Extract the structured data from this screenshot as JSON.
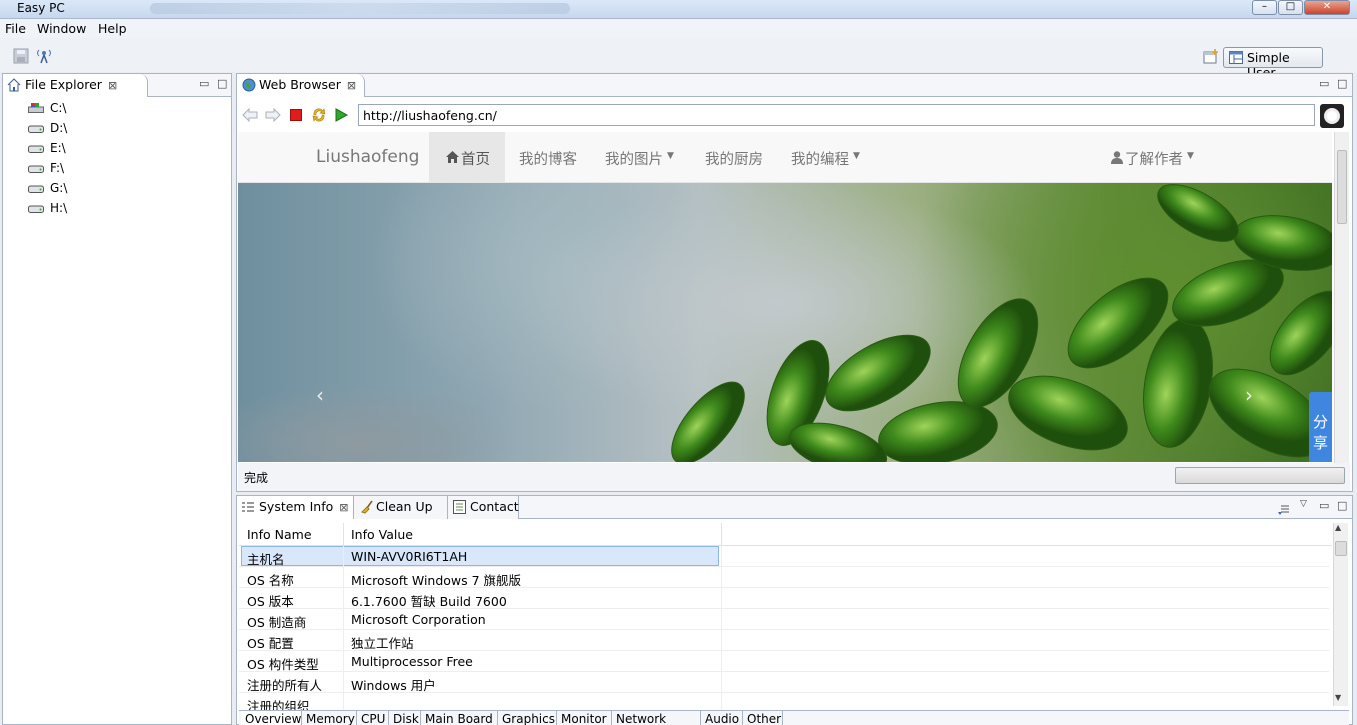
{
  "window": {
    "title": "Easy PC",
    "title_path_blurred": "",
    "controls": {
      "minimize": "–",
      "maximize": "□",
      "close": "✕"
    }
  },
  "menu": [
    "File",
    "Window",
    "Help"
  ],
  "toolbar": {
    "perspective_label": "Simple User"
  },
  "file_explorer": {
    "tab_label": "File Explorer",
    "drives": [
      "C:\\",
      "D:\\",
      "E:\\",
      "F:\\",
      "G:\\",
      "H:\\"
    ]
  },
  "browser": {
    "tab_label": "Web Browser",
    "url": "http://liushaofeng.cn/",
    "site": {
      "brand": "Liushaofeng",
      "nav": [
        "首页",
        "我的博客",
        "我的图片",
        "我的厨房",
        "我的编程"
      ],
      "nav_dropdown": [
        false,
        false,
        true,
        false,
        true
      ],
      "author_menu": "了解作者",
      "share_button": "分享",
      "carousel_prev": "‹",
      "carousel_next": "›"
    },
    "status_text": "完成"
  },
  "bottom_tabs": [
    "System Info",
    "Clean Up",
    "Contact"
  ],
  "system_info": {
    "headers": [
      "Info Name",
      "Info Value"
    ],
    "rows": [
      [
        "主机名",
        "WIN-AVV0RI6T1AH"
      ],
      [
        "OS 名称",
        "Microsoft Windows 7 旗舰版"
      ],
      [
        "OS 版本",
        "6.1.7600 暂缺 Build 7600"
      ],
      [
        "OS 制造商",
        "Microsoft Corporation"
      ],
      [
        "OS 配置",
        "独立工作站"
      ],
      [
        "OS 构件类型",
        "Multiprocessor Free"
      ],
      [
        "注册的所有人",
        "Windows 用户"
      ],
      [
        "注册的组织",
        ""
      ]
    ],
    "category_tabs": [
      "Overview",
      "Memory",
      "CPU",
      "Disk",
      "Main Board",
      "Graphics",
      "Monitor",
      "Network Card",
      "Audio",
      "Other"
    ]
  },
  "colors": {
    "accent_blue": "#3f86e0",
    "stop_red": "#e01c1c",
    "go_green": "#2ea82e"
  }
}
